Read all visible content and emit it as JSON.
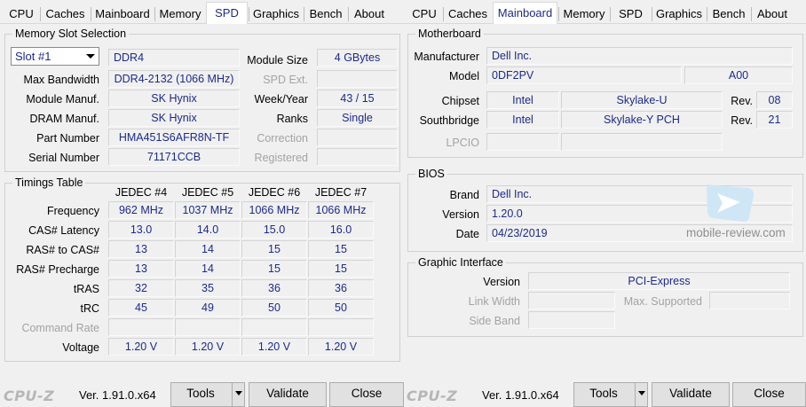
{
  "left": {
    "tabs": [
      "CPU",
      "Caches",
      "Mainboard",
      "Memory",
      "SPD",
      "Graphics",
      "Bench",
      "About"
    ],
    "slot": {
      "title": "Memory Slot Selection",
      "selected_slot": "Slot #1",
      "type": "DDR4",
      "module_size_label": "Module Size",
      "module_size": "4 GBytes",
      "max_bandwidth_label": "Max Bandwidth",
      "max_bandwidth": "DDR4-2132 (1066 MHz)",
      "spd_ext_label": "SPD Ext.",
      "spd_ext": "",
      "module_manuf_label": "Module Manuf.",
      "module_manuf": "SK Hynix",
      "week_year_label": "Week/Year",
      "week_year": "43 / 15",
      "dram_manuf_label": "DRAM Manuf.",
      "dram_manuf": "SK Hynix",
      "ranks_label": "Ranks",
      "ranks": "Single",
      "part_number_label": "Part Number",
      "part_number": "HMA451S6AFR8N-TF",
      "correction_label": "Correction",
      "correction": "",
      "serial_number_label": "Serial Number",
      "serial_number": "71171CCB",
      "registered_label": "Registered",
      "registered": ""
    },
    "timings": {
      "title": "Timings Table",
      "columns": [
        "JEDEC #4",
        "JEDEC #5",
        "JEDEC #6",
        "JEDEC #7"
      ],
      "rows": [
        {
          "label": "Frequency",
          "values": [
            "962 MHz",
            "1037 MHz",
            "1066 MHz",
            "1066 MHz"
          ]
        },
        {
          "label": "CAS# Latency",
          "values": [
            "13.0",
            "14.0",
            "15.0",
            "16.0"
          ]
        },
        {
          "label": "RAS# to CAS#",
          "values": [
            "13",
            "14",
            "15",
            "15"
          ]
        },
        {
          "label": "RAS# Precharge",
          "values": [
            "13",
            "14",
            "15",
            "15"
          ]
        },
        {
          "label": "tRAS",
          "values": [
            "32",
            "35",
            "36",
            "36"
          ]
        },
        {
          "label": "tRC",
          "values": [
            "45",
            "49",
            "50",
            "50"
          ]
        },
        {
          "label": "Command Rate",
          "values": [
            "",
            "",
            "",
            ""
          ]
        },
        {
          "label": "Voltage",
          "values": [
            "1.20 V",
            "1.20 V",
            "1.20 V",
            "1.20 V"
          ]
        }
      ]
    },
    "footer": {
      "logo": "CPU-Z",
      "version": "Ver. 1.91.0.x64",
      "tools": "Tools",
      "validate": "Validate",
      "close": "Close"
    }
  },
  "right": {
    "tabs": [
      "CPU",
      "Caches",
      "Mainboard",
      "Memory",
      "SPD",
      "Graphics",
      "Bench",
      "About"
    ],
    "motherboard": {
      "title": "Motherboard",
      "manufacturer_label": "Manufacturer",
      "manufacturer": "Dell Inc.",
      "model_label": "Model",
      "model": "0DF2PV",
      "model_rev": "A00",
      "chipset_label": "Chipset",
      "chipset_vendor": "Intel",
      "chipset_name": "Skylake-U",
      "chipset_rev_label": "Rev.",
      "chipset_rev": "08",
      "southbridge_label": "Southbridge",
      "southbridge_vendor": "Intel",
      "southbridge_name": "Skylake-Y PCH",
      "southbridge_rev_label": "Rev.",
      "southbridge_rev": "21",
      "lpcio_label": "LPCIO",
      "lpcio_vendor": "",
      "lpcio_name": ""
    },
    "bios": {
      "title": "BIOS",
      "brand_label": "Brand",
      "brand": "Dell Inc.",
      "version_label": "Version",
      "version": "1.20.0",
      "date_label": "Date",
      "date": "04/23/2019"
    },
    "graphic_interface": {
      "title": "Graphic Interface",
      "version_label": "Version",
      "version": "PCI-Express",
      "link_width_label": "Link Width",
      "link_width": "",
      "max_supported_label": "Max. Supported",
      "max_supported": "",
      "side_band_label": "Side Band",
      "side_band": ""
    },
    "watermark": "mobile-review.com",
    "footer": {
      "logo": "CPU-Z",
      "version": "Ver. 1.91.0.x64",
      "tools": "Tools",
      "validate": "Validate",
      "close": "Close"
    }
  },
  "colors": {
    "value_text": "#1c2a8c",
    "active_tab_text": "#1d2a86",
    "disabled_text": "#a3a3a3",
    "window_bg": "#f0f0f0"
  }
}
